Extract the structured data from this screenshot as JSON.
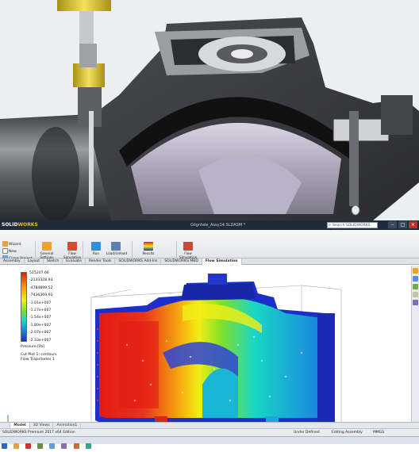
{
  "app": {
    "logo_main": "SOLID",
    "logo_sub": "WORKS",
    "title": "Gligntele_Assy14.SLDASM *",
    "search_placeholder": "Search SOLIDWORKS Help"
  },
  "ribbon": {
    "wizard": "Wizard",
    "new": "New",
    "clone_project": "Clone Project",
    "general_settings": "General Settings",
    "flow_simulation": "Flow Simulation",
    "run": "Run",
    "load_unload": "Load/Unload",
    "results": "Results",
    "flow_simulation_2": "Flow Simulation"
  },
  "tabs": [
    "Assembly",
    "Layout",
    "Sketch",
    "Evaluate",
    "Render Tools",
    "SOLIDWORKS Add-Ins",
    "SOLIDWORKS MBD",
    "Flow Simulation"
  ],
  "active_tab": "Flow Simulation",
  "legend": {
    "values": [
      "515207.66",
      "-2133328.93",
      "-4784899.52",
      "-7436369.93",
      "-1.01e+007",
      "-1.27e+007",
      "-1.54e+007",
      "-1.80e+007",
      "-2.07e+007",
      "-2.33e+007"
    ],
    "unit": "Pressure [Pa]",
    "cut_plot": "Cut Plot 1: contours",
    "flow_traj": "Flow Trajectories 1"
  },
  "bottom_tabs": [
    "Model",
    "3D Views",
    "Animation1"
  ],
  "status": {
    "edition": "SOLIDWORKS Premium 2017 x64 Edition",
    "state": "Under Defined",
    "mode": "Editing Assembly",
    "units": "MMGS"
  },
  "colors": {
    "titlebar": "#1f2b3a",
    "pressure_high": "#e31b12",
    "pressure_low": "#1d2fc9"
  }
}
